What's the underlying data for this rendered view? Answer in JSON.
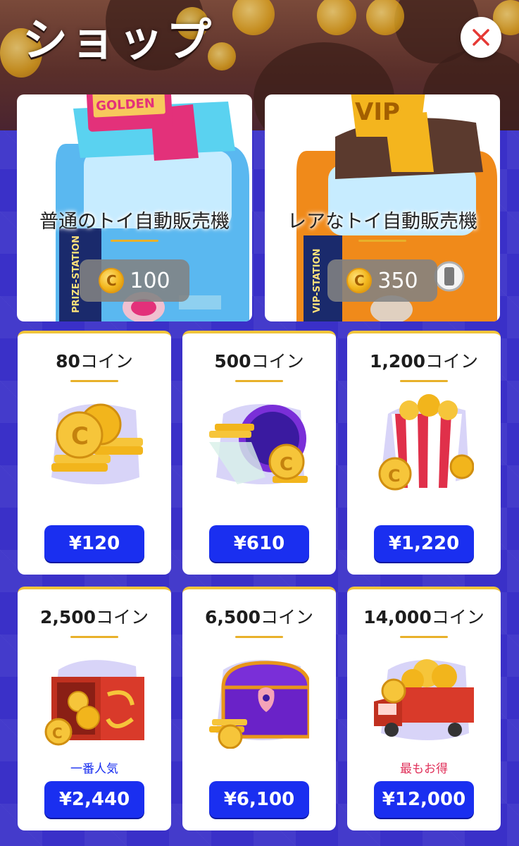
{
  "header": {
    "title": "ショップ",
    "close_icon": "close-icon"
  },
  "machines": [
    {
      "name": "普通のトイ自動販売機",
      "price": "100",
      "sign": "GOLDEN",
      "side_text": "PRIZE-STATION",
      "color": "#e8317a"
    },
    {
      "name": "レアなトイ自動販売機",
      "price": "350",
      "sign": "VIP",
      "side_text": "VIP-STATION",
      "color": "#f08a1a"
    }
  ],
  "packs": [
    {
      "amount": "80",
      "unit": "コイン",
      "price": "¥120",
      "tag": ""
    },
    {
      "amount": "500",
      "unit": "コイン",
      "price": "¥610",
      "tag": ""
    },
    {
      "amount": "1,200",
      "unit": "コイン",
      "price": "¥1,220",
      "tag": ""
    },
    {
      "amount": "2,500",
      "unit": "コイン",
      "price": "¥2,440",
      "tag": "一番人気"
    },
    {
      "amount": "6,500",
      "unit": "コイン",
      "price": "¥6,100",
      "tag": ""
    },
    {
      "amount": "14,000",
      "unit": "コイン",
      "price": "¥12,000",
      "tag": "最もお得"
    }
  ],
  "colors": {
    "background": "#3a30c8",
    "price_button": "#1a2ff0",
    "accent_gold": "#e8b12a",
    "tag_popular": "#1a2ff0",
    "tag_best": "#e0305a",
    "close_x": "#e53935"
  }
}
